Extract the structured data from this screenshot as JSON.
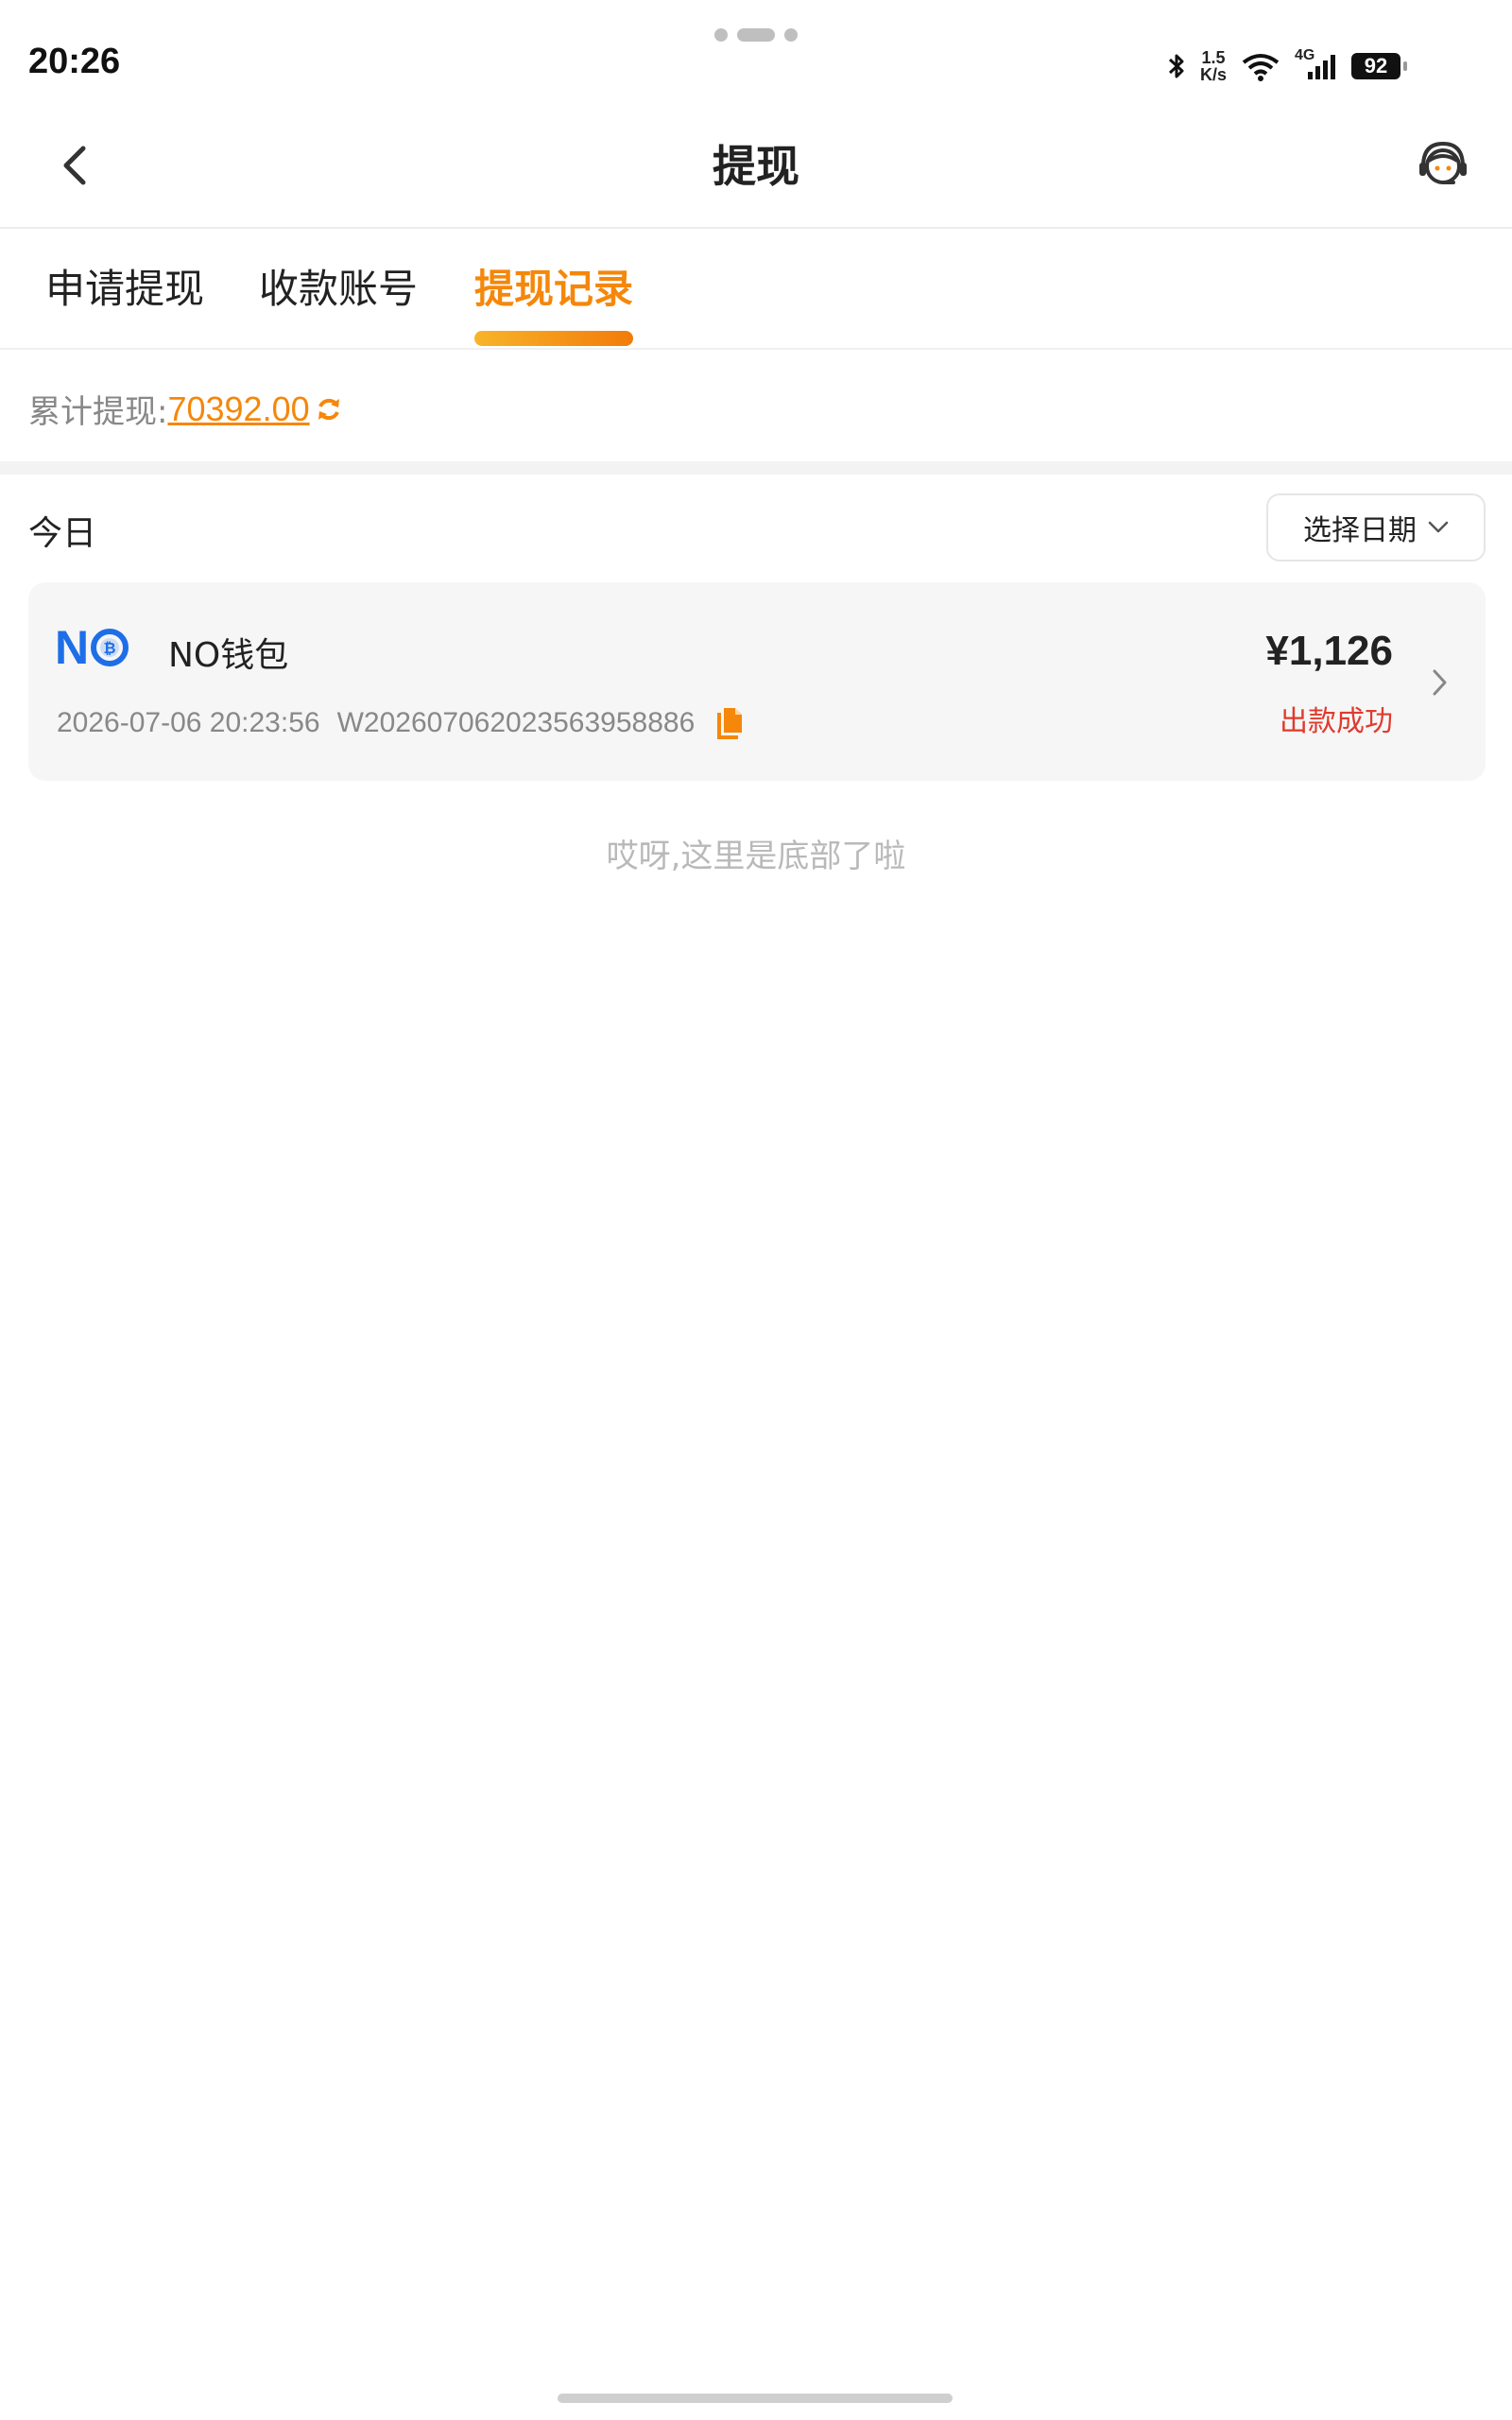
{
  "status_bar": {
    "time": "20:26",
    "network_speed_value": "1.5",
    "network_speed_unit": "K/s",
    "signal_label": "4G",
    "battery": "92"
  },
  "nav": {
    "title": "提现"
  },
  "tabs": [
    {
      "label": "申请提现",
      "active": false
    },
    {
      "label": "收款账号",
      "active": false
    },
    {
      "label": "提现记录",
      "active": true
    }
  ],
  "summary": {
    "label": "累计提现:",
    "value": "70392.00"
  },
  "section": {
    "label": "今日",
    "date_select_label": "选择日期"
  },
  "records": [
    {
      "wallet_logo_text": "N",
      "wallet_name": "NO钱包",
      "datetime": "2026-07-06 20:23:56",
      "order_no": "W20260706202356395888​6",
      "amount": "¥1,126",
      "status": "出款成功"
    }
  ],
  "footer": {
    "end_text": "哎呀,这里是底部了啦"
  },
  "colors": {
    "accent": "#f5870a",
    "status_success": "#e03a2e",
    "brand_blue": "#1e6ee8"
  },
  "icons": {
    "back": "chevron-left-icon",
    "service": "customer-service-icon",
    "refresh": "refresh-icon",
    "dropdown": "chevron-down-icon",
    "copy": "copy-icon",
    "detail": "chevron-right-icon"
  }
}
